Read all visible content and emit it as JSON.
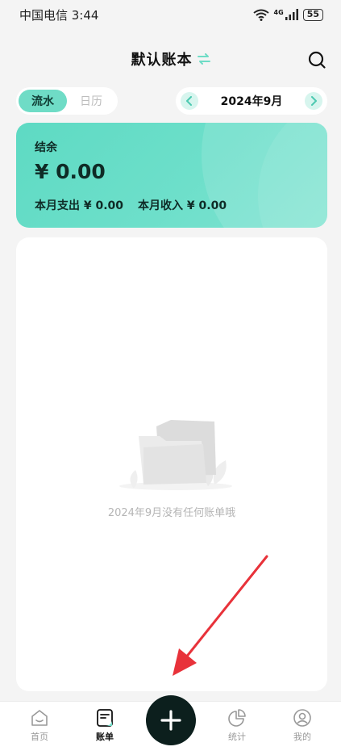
{
  "status_bar": {
    "carrier_time": "中国电信 3:44",
    "network": "4G",
    "battery": "55"
  },
  "header": {
    "title": "默认账本",
    "swap_icon": "swap-arrows-icon",
    "search_icon": "search-icon"
  },
  "view_toggle": {
    "options": [
      "流水",
      "日历"
    ],
    "selected": "流水"
  },
  "month_picker": {
    "label": "2024年9月",
    "prev_icon": "chevron-left-icon",
    "next_icon": "chevron-right-icon"
  },
  "balance_card": {
    "label": "结余",
    "amount": "¥ 0.00",
    "expense": "本月支出 ¥ 0.00",
    "income": "本月收入 ¥ 0.00"
  },
  "empty_state": {
    "message": "2024年9月没有任何账单哦",
    "illustration": "empty-folder-icon"
  },
  "tab_bar": {
    "tabs": [
      {
        "label": "首页",
        "icon": "home-icon"
      },
      {
        "label": "账单",
        "icon": "bill-icon"
      },
      {
        "label": "统计",
        "icon": "pie-chart-icon"
      },
      {
        "label": "我的",
        "icon": "profile-icon"
      }
    ],
    "active": "账单",
    "fab_icon": "plus-icon"
  },
  "colors": {
    "accent": "#6fdcc6",
    "card": "#5edac3",
    "fab": "#0c1f1d",
    "annotation": "#e8323a"
  }
}
